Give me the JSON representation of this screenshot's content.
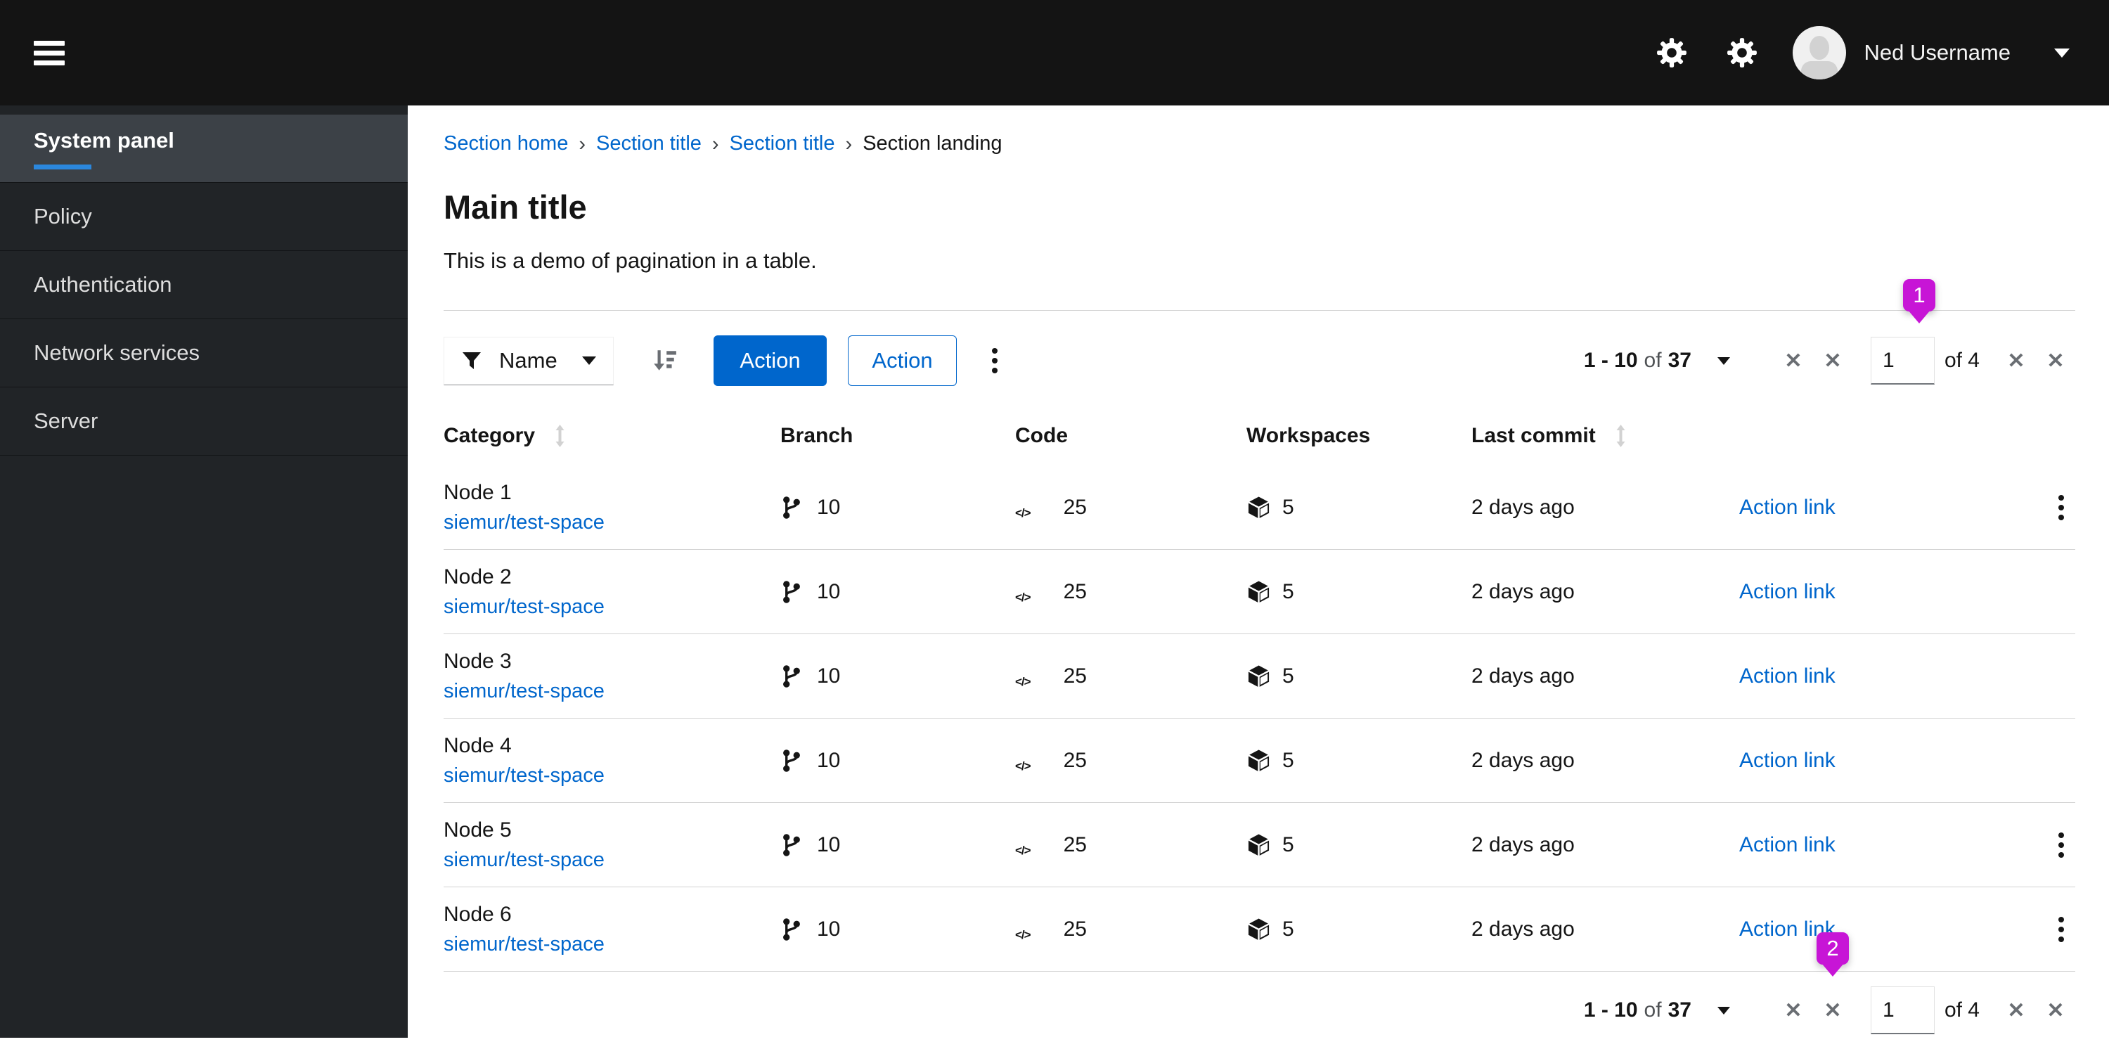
{
  "masthead": {
    "username": "Ned Username"
  },
  "sidebar": {
    "items": [
      {
        "label": "System panel",
        "active": true
      },
      {
        "label": "Policy",
        "active": false
      },
      {
        "label": "Authentication",
        "active": false
      },
      {
        "label": "Network services",
        "active": false
      },
      {
        "label": "Server",
        "active": false
      }
    ]
  },
  "breadcrumb": {
    "items": [
      {
        "label": "Section home",
        "type": "link"
      },
      {
        "label": "Section title",
        "type": "link"
      },
      {
        "label": "Section title",
        "type": "link"
      },
      {
        "label": "Section landing",
        "type": "current"
      }
    ]
  },
  "page": {
    "title": "Main title",
    "subtitle": "This is a demo of pagination in a table."
  },
  "toolbar": {
    "filter_label": "Name",
    "primary_action_label": "Action",
    "secondary_action_label": "Action"
  },
  "pagination": {
    "range": "1 - 10",
    "of_label": "of",
    "total": "37",
    "page_value": "1",
    "pages_label": "of 4"
  },
  "table": {
    "columns": [
      {
        "label": "Category",
        "sortable": true
      },
      {
        "label": "Branch",
        "sortable": false
      },
      {
        "label": "Code",
        "sortable": false
      },
      {
        "label": "Workspaces",
        "sortable": false
      },
      {
        "label": "Last commit",
        "sortable": true
      }
    ],
    "rows": [
      {
        "name": "Node 1",
        "link": "siemur/test-space",
        "branch": "10",
        "code": "25",
        "workspaces": "5",
        "last_commit": "2 days ago",
        "action": "Action link",
        "kebab": true
      },
      {
        "name": "Node 2",
        "link": "siemur/test-space",
        "branch": "10",
        "code": "25",
        "workspaces": "5",
        "last_commit": "2 days ago",
        "action": "Action link",
        "kebab": false
      },
      {
        "name": "Node 3",
        "link": "siemur/test-space",
        "branch": "10",
        "code": "25",
        "workspaces": "5",
        "last_commit": "2 days ago",
        "action": "Action link",
        "kebab": false
      },
      {
        "name": "Node 4",
        "link": "siemur/test-space",
        "branch": "10",
        "code": "25",
        "workspaces": "5",
        "last_commit": "2 days ago",
        "action": "Action link",
        "kebab": false
      },
      {
        "name": "Node 5",
        "link": "siemur/test-space",
        "branch": "10",
        "code": "25",
        "workspaces": "5",
        "last_commit": "2 days ago",
        "action": "Action link",
        "kebab": true
      },
      {
        "name": "Node 6",
        "link": "siemur/test-space",
        "branch": "10",
        "code": "25",
        "workspaces": "5",
        "last_commit": "2 days ago",
        "action": "Action link",
        "kebab": true
      }
    ]
  },
  "annotations": {
    "badge_1": "1",
    "badge_2": "2"
  },
  "icons": {
    "close": "✕",
    "breadcrumb_separator": "›",
    "code_glyph": "</>"
  },
  "colors": {
    "primary_blue": "#0066cc",
    "link_blue": "#0066cc",
    "masthead_bg": "#141414",
    "sidebar_bg": "#212427",
    "sidebar_active_bg": "#3c4147",
    "nav_active_underline": "#2b87dd",
    "row_border": "#d2d2d2",
    "pagination_icon_gray": "#6a6e73",
    "annotation_magenta": "#c715d6"
  }
}
